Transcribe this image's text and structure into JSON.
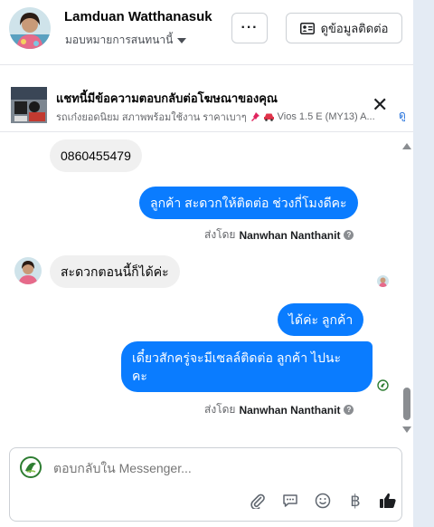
{
  "header": {
    "customer_name": "Lamduan Watthanasuk",
    "assign_label": "มอบหมายการสนทนานี้",
    "more_label": "···",
    "contact_button_label": "ดูข้อมูลติดต่อ"
  },
  "banner": {
    "title": "แชทนี้มีข้อความตอบกลับต่อโฆษณาของคุณ",
    "subtitle": "รถเก๋งยอดนิยม สภาพพร้อมใช้งาน ราคาเบาๆ",
    "subtitle_model": "Vios 1.5 E (MY13) A...",
    "link_peek": "ดู"
  },
  "messages": [
    {
      "direction": "in",
      "text": "0860455479"
    },
    {
      "direction": "out",
      "text": "ลูกค้า สะดวกให้ติดต่อ ช่วงกี่โมงดีคะ"
    },
    {
      "direction": "in",
      "text": "สะดวกตอนนี้ก็ได้ค่ะ"
    },
    {
      "direction": "out",
      "text": "ได้ค่ะ  ลูกค้า"
    },
    {
      "direction": "out",
      "text_line1": "เดี๋ยวสักครู่จะมีเซลล์ติดต่อ ลูกค้า  ไปนะ",
      "text_line2": "คะ"
    }
  ],
  "sent_by": {
    "prefix": "ส่งโดย",
    "agent": "Nanwhan Nanthanit",
    "help": "?"
  },
  "composer": {
    "placeholder": "ตอบกลับใน Messenger...",
    "tools": [
      "attach-icon",
      "saved-reply-icon",
      "emoji-icon",
      "baht-icon",
      "like-icon"
    ]
  },
  "colors": {
    "outgoing": "#0a7cff",
    "incoming": "#f0f0f0",
    "like": "#1c1e21"
  }
}
